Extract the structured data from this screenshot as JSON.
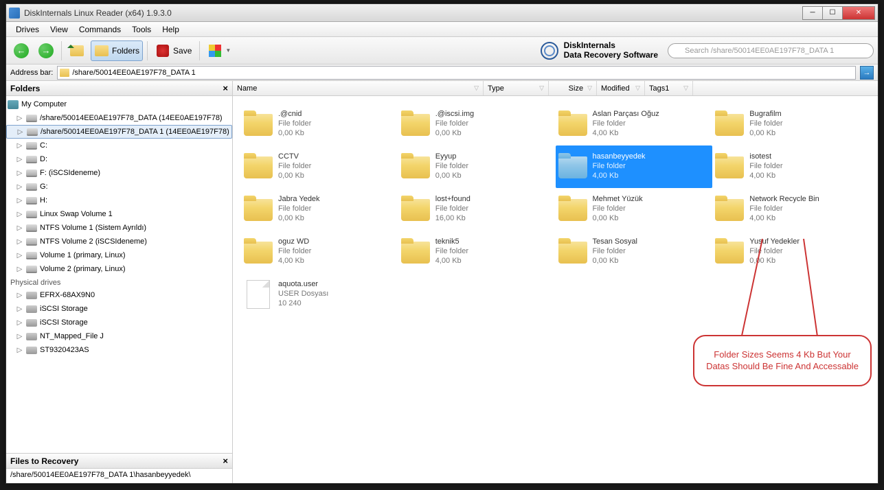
{
  "window": {
    "title": "DiskInternals Linux Reader (x64) 1.9.3.0"
  },
  "menu": {
    "drives": "Drives",
    "view": "View",
    "commands": "Commands",
    "tools": "Tools",
    "help": "Help"
  },
  "toolbar": {
    "folders": "Folders",
    "save": "Save"
  },
  "brand": {
    "line1": "DiskInternals",
    "line2": "Data Recovery Software"
  },
  "search": {
    "placeholder": "Search /share/50014EE0AE197F78_DATA 1"
  },
  "address": {
    "label": "Address bar:",
    "value": "/share/50014EE0AE197F78_DATA 1"
  },
  "sidebar": {
    "folders_title": "Folders",
    "physical_label": "Physical drives",
    "files_title": "Files to Recovery",
    "files_path": "/share/50014EE0AE197F78_DATA 1\\hasanbeyyedek\\",
    "root": "My Computer",
    "tree": [
      {
        "label": "/share/50014EE0AE197F78_DATA (14EE0AE197F78)",
        "icon": "drive"
      },
      {
        "label": "/share/50014EE0AE197F78_DATA 1 (14EE0AE197F78)",
        "icon": "drive",
        "selected": true
      },
      {
        "label": "C:",
        "icon": "drive"
      },
      {
        "label": "D:",
        "icon": "drive"
      },
      {
        "label": "F: (iSCSIdeneme)",
        "icon": "drive"
      },
      {
        "label": "G:",
        "icon": "drive"
      },
      {
        "label": "H:",
        "icon": "drive"
      },
      {
        "label": "Linux Swap Volume 1",
        "icon": "drive"
      },
      {
        "label": "NTFS Volume 1 (Sistem Ayrıldı)",
        "icon": "drive"
      },
      {
        "label": "NTFS Volume 2 (iSCSIdeneme)",
        "icon": "drive"
      },
      {
        "label": "Volume 1 (primary, Linux)",
        "icon": "drive"
      },
      {
        "label": "Volume 2 (primary, Linux)",
        "icon": "drive"
      }
    ],
    "physical": [
      {
        "label": "EFRX-68AX9N0"
      },
      {
        "label": "iSCSI Storage"
      },
      {
        "label": "iSCSI Storage"
      },
      {
        "label": "NT_Mapped_File J"
      },
      {
        "label": "ST9320423AS"
      }
    ]
  },
  "columns": {
    "name": "Name",
    "type": "Type",
    "size": "Size",
    "modified": "Modified",
    "tags1": "Tags1"
  },
  "items": [
    {
      "name": ".@cnid",
      "type": "File folder",
      "size": "0,00 Kb",
      "kind": "folder"
    },
    {
      "name": ".@iscsi.img",
      "type": "File folder",
      "size": "0,00 Kb",
      "kind": "folder"
    },
    {
      "name": "Aslan Parçası Oğuz",
      "type": "File folder",
      "size": "4,00 Kb",
      "kind": "folder"
    },
    {
      "name": "Bugrafilm",
      "type": "File folder",
      "size": "0,00 Kb",
      "kind": "folder"
    },
    {
      "name": "CCTV",
      "type": "File folder",
      "size": "0,00 Kb",
      "kind": "folder"
    },
    {
      "name": "Eyyup",
      "type": "File folder",
      "size": "0,00 Kb",
      "kind": "folder"
    },
    {
      "name": "hasanbeyyedek",
      "type": "File folder",
      "size": "4,00 Kb",
      "kind": "folder",
      "selected": true
    },
    {
      "name": "isotest",
      "type": "File folder",
      "size": "4,00 Kb",
      "kind": "folder"
    },
    {
      "name": "Jabra Yedek",
      "type": "File folder",
      "size": "0,00 Kb",
      "kind": "folder"
    },
    {
      "name": "lost+found",
      "type": "File folder",
      "size": "16,00 Kb",
      "kind": "folder"
    },
    {
      "name": "Mehmet Yüzük",
      "type": "File folder",
      "size": "0,00 Kb",
      "kind": "folder"
    },
    {
      "name": "Network Recycle Bin",
      "type": "File folder",
      "size": "4,00 Kb",
      "kind": "folder"
    },
    {
      "name": "oguz WD",
      "type": "File folder",
      "size": "4,00 Kb",
      "kind": "folder"
    },
    {
      "name": "teknik5",
      "type": "File folder",
      "size": "4,00 Kb",
      "kind": "folder"
    },
    {
      "name": "Tesan Sosyal",
      "type": "File folder",
      "size": "0,00 Kb",
      "kind": "folder"
    },
    {
      "name": "Yusuf Yedekler",
      "type": "File folder",
      "size": "0,00 Kb",
      "kind": "folder"
    },
    {
      "name": "aquota.user",
      "type": "USER Dosyası",
      "size": "10 240",
      "kind": "file"
    }
  ],
  "callout": {
    "text": "Folder Sizes Seems 4 Kb But Your Datas Should Be Fine And Accessable"
  }
}
